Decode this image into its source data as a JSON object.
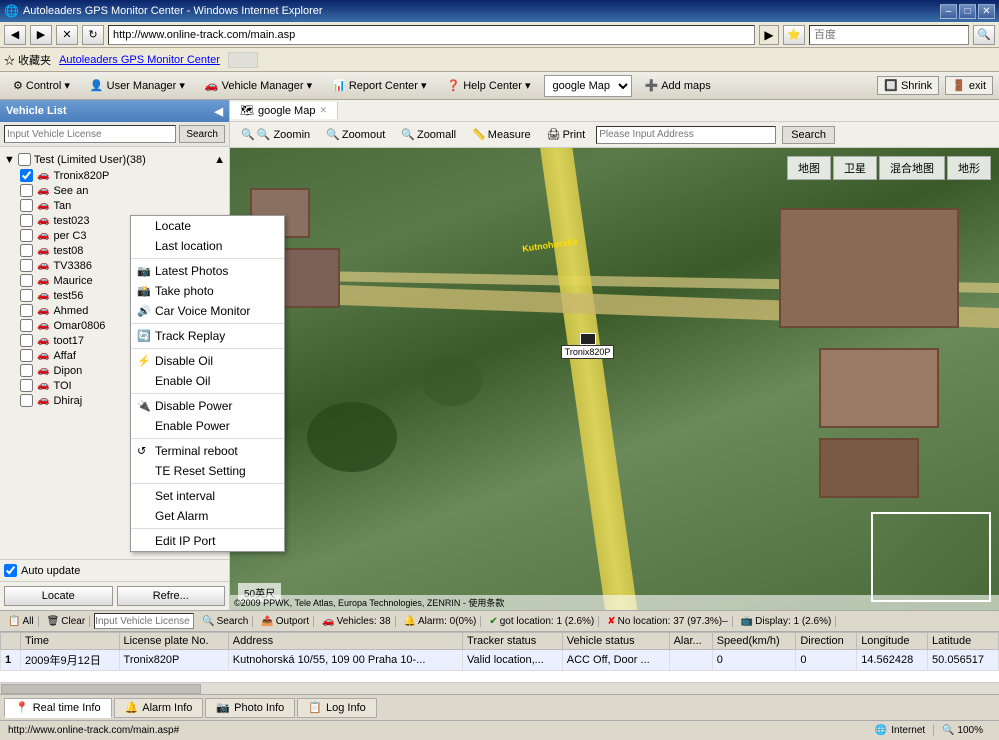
{
  "window": {
    "title": "Autoleaders GPS Monitor Center - Windows Internet Explorer",
    "minimize": "–",
    "restore": "□",
    "close": "✕"
  },
  "browser": {
    "back": "◀",
    "forward": "▶",
    "address": "http://www.online-track.com/main.asp",
    "search_placeholder": "百度",
    "favorites_label": "☆ 收藏夹",
    "favorites_link": "Autoleaders GPS Monitor Center"
  },
  "menubar": {
    "control": "⚙ Control",
    "user_manager": "👤 User Manager",
    "vehicle_manager": "🚗 Vehicle Manager",
    "report_center": "📊 Report Center",
    "help_center": "❓ Help Center",
    "map_select_default": "google Map",
    "add_maps": "➕ Add maps",
    "shrink": "🔲 Shrink",
    "exit": "🚪 exit"
  },
  "vehicle_list": {
    "title": "Vehicle List",
    "collapse_btn": "◀",
    "search_placeholder": "Input Vehicle License",
    "search_btn": "Search",
    "root_label": "Test (Limited User)(38)",
    "vehicles": [
      {
        "name": "Tronix820P",
        "checked": true
      },
      {
        "name": "See an"
      },
      {
        "name": "Tan"
      },
      {
        "name": "test023"
      },
      {
        "name": "per C3"
      },
      {
        "name": "test08"
      },
      {
        "name": "TV3386"
      },
      {
        "name": "Maurice"
      },
      {
        "name": "test56"
      },
      {
        "name": "Ahmed"
      },
      {
        "name": "Omar0806"
      },
      {
        "name": "toot17"
      },
      {
        "name": "Affaf"
      },
      {
        "name": "Dipon"
      },
      {
        "name": "TOI"
      },
      {
        "name": "Dhiraj"
      }
    ],
    "auto_update": "Auto update",
    "locate_btn": "Locate",
    "refresh_btn": "Refre..."
  },
  "context_menu": {
    "items": [
      {
        "label": "Locate",
        "icon": ""
      },
      {
        "label": "Last location",
        "icon": ""
      },
      {
        "label": "Latest Photos",
        "icon": "📷"
      },
      {
        "label": "Take photo",
        "icon": "📸"
      },
      {
        "label": "Car Voice Monitor",
        "icon": "🔊"
      },
      {
        "label": "Track Replay",
        "icon": "🔄"
      },
      {
        "label": "Disable Oil",
        "icon": "⚡"
      },
      {
        "label": "Enable Oil",
        "icon": ""
      },
      {
        "label": "Disable Power",
        "icon": "🔌"
      },
      {
        "label": "Enable Power",
        "icon": ""
      },
      {
        "label": "Terminal reboot",
        "icon": "↺"
      },
      {
        "label": "TE Reset Setting",
        "icon": ""
      },
      {
        "label": "Set interval",
        "icon": ""
      },
      {
        "label": "Get Alarm",
        "icon": ""
      },
      {
        "label": "Edit IP Port",
        "icon": ""
      }
    ]
  },
  "map": {
    "tab_label": "google Map",
    "tab_close": "✕",
    "toolbar": {
      "zoomin": "🔍 Zoomin",
      "zoomout": "🔍 Zoomout",
      "zoomall": "🔍 Zoomall",
      "measure": "📏 Measure",
      "print": "🖨 Print",
      "address_placeholder": "Please Input Address",
      "search_btn": "Search"
    },
    "controls": [
      "地图",
      "卫星",
      "混合地图",
      "地形"
    ],
    "vehicle_label": "Tronix820P",
    "scale": "50英尺",
    "copyright": "©2009 PPWK, Tele Atlas, Europa Technologies, ZENRIN - 使用条款"
  },
  "status_bar": {
    "all": "All",
    "clear": "Clear",
    "input_license": "Input Vehicle License",
    "search": "Search",
    "outport": "Outport",
    "vehicles": "Vehicles: 38",
    "alarm": "Alarm: 0(0%)",
    "got_location": "got location: 1 (2.6%)",
    "no_location": "No location: 37 (97.3%)–",
    "display": "Display: 1 (2.6%)"
  },
  "table": {
    "headers": [
      "Time",
      "License plate No.",
      "Address",
      "Tracker status",
      "Vehicle status",
      "Alar...",
      "Speed(km/h)",
      "Direction",
      "Longitude",
      "Latitude"
    ],
    "rows": [
      {
        "num": "1",
        "time": "2009年9月12日",
        "license": "Tronix820P",
        "address": "Kutnohorská 10/55, 109 00 Praha 10-...",
        "tracker": "Valid location,...",
        "vehicle": "ACC Off, Door ...",
        "alarm": "",
        "speed": "0",
        "direction": "0",
        "longitude": "14.562428",
        "latitude": "50.056517"
      }
    ]
  },
  "bottom_tabs": [
    {
      "label": "Real time Info",
      "icon": "📍",
      "active": true
    },
    {
      "label": "Alarm Info",
      "icon": "🔔",
      "active": false
    },
    {
      "label": "Photo Info",
      "icon": "📷",
      "active": false
    },
    {
      "label": "Log Info",
      "icon": "📋",
      "active": false
    }
  ],
  "ie_status": {
    "url": "http://www.online-track.com/main.asp#",
    "zone_icon": "🌐",
    "zone_label": "Internet",
    "zoom": "🔍 100%"
  }
}
